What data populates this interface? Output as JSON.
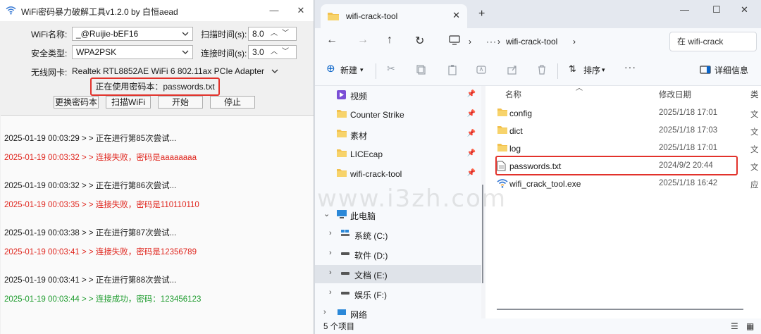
{
  "tool": {
    "title": "WiFi密码暴力破解工具v1.2.0 by 白恒aead",
    "wifi_label": "WiFi名称:",
    "wifi_value": "_@Ruijie-bEF16",
    "security_label": "安全类型:",
    "security_value": "WPA2PSK",
    "adapter_label": "无线网卡:",
    "adapter_value": "Realtek RTL8852AE WiFi 6 802.11ax PCIe Adapter",
    "scan_time_label": "扫描时间(s):",
    "scan_time_value": "8.0",
    "connect_time_label": "连接时间(s):",
    "connect_time_value": "3.0",
    "status_text": "正在使用密码本：passwords.txt",
    "buttons": {
      "change_dict": "更换密码本",
      "scan_wifi": "扫描WiFi",
      "start": "开始",
      "stop": "停止"
    },
    "log": [
      {
        "text": "2025-01-19 00:03:29 > > 正在进行第85次尝试...",
        "color": "#1a1a1a"
      },
      {
        "text": "2025-01-19 00:03:32 > > 连接失败，密码是aaaaaaaa",
        "color": "#e0261e"
      },
      {
        "text": "2025-01-19 00:03:32 > > 正在进行第86次尝试...",
        "color": "#1a1a1a"
      },
      {
        "text": "2025-01-19 00:03:35 > > 连接失败，密码是110110110",
        "color": "#e0261e"
      },
      {
        "text": "2025-01-19 00:03:38 > > 正在进行第87次尝试...",
        "color": "#1a1a1a"
      },
      {
        "text": "2025-01-19 00:03:41 > > 连接失败，密码是12356789",
        "color": "#e0261e"
      },
      {
        "text": "2025-01-19 00:03:41 > > 正在进行第88次尝试...",
        "color": "#1a1a1a"
      },
      {
        "text": "2025-01-19 00:03:44 > > 连接成功，密码：123456123",
        "color": "#1e9c2e"
      }
    ]
  },
  "explorer": {
    "tab_title": "wifi-crack-tool",
    "breadcrumb": "wifi-crack-tool",
    "search_placeholder": "在 wifi-crack",
    "commands": {
      "new": "新建",
      "sort": "排序",
      "details": "详细信息"
    },
    "nav_items": [
      {
        "label": "视频",
        "icon": "video-icon",
        "pinned": true
      },
      {
        "label": "Counter Strike",
        "icon": "folder-icon",
        "pinned": true
      },
      {
        "label": "素材",
        "icon": "folder-icon",
        "pinned": true
      },
      {
        "label": "LICEcap",
        "icon": "folder-icon",
        "pinned": true
      },
      {
        "label": "wifi-crack-tool",
        "icon": "folder-icon",
        "pinned": true
      }
    ],
    "tree": [
      {
        "label": "此电脑",
        "icon": "pc-icon",
        "expanded": true
      },
      {
        "label": "系统 (C:)",
        "icon": "drive-icon"
      },
      {
        "label": "软件 (D:)",
        "icon": "drive-icon"
      },
      {
        "label": "文档 (E:)",
        "icon": "drive-icon",
        "selected": true
      },
      {
        "label": "娱乐 (F:)",
        "icon": "drive-icon"
      },
      {
        "label": "网络",
        "icon": "network-icon"
      }
    ],
    "columns": {
      "name": "名称",
      "date": "修改日期",
      "type": "类"
    },
    "files": [
      {
        "name": "config",
        "date": "2025/1/18 17:01",
        "type": "文",
        "icon": "folder-icon"
      },
      {
        "name": "dict",
        "date": "2025/1/18 17:03",
        "type": "文",
        "icon": "folder-icon"
      },
      {
        "name": "log",
        "date": "2025/1/18 17:01",
        "type": "文",
        "icon": "folder-icon"
      },
      {
        "name": "passwords.txt",
        "date": "2024/9/2 20:44",
        "type": "文",
        "icon": "text-file-icon"
      },
      {
        "name": "wifi_crack_tool.exe",
        "date": "2025/1/18 16:42",
        "type": "应",
        "icon": "wifi-app-icon"
      }
    ],
    "status": "5 个项目"
  },
  "watermark": "www.i3zh.com",
  "colors": {
    "highlight": "#e2322b",
    "fail": "#e0261e",
    "success": "#1e9c2e",
    "folder": "#f2c14e"
  }
}
